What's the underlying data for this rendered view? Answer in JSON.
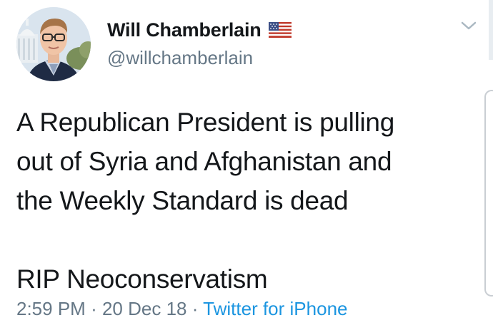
{
  "tweet": {
    "author": {
      "display_name": "Will Chamberlain",
      "handle": "@willchamberlain",
      "badge_icon": "us-flag-icon"
    },
    "text_lines": [
      "A Republican President is pulling",
      "out of Syria and Afghanistan and",
      "the Weekly Standard is dead",
      "",
      "RIP Neoconservatism"
    ],
    "time": "2:59 PM",
    "separator": "·",
    "date": "20 Dec 18",
    "source": "Twitter for iPhone",
    "menu_icon": "chevron-down-icon"
  },
  "colors": {
    "text": "#14171a",
    "secondary": "#657786",
    "link": "#1b95e0"
  }
}
